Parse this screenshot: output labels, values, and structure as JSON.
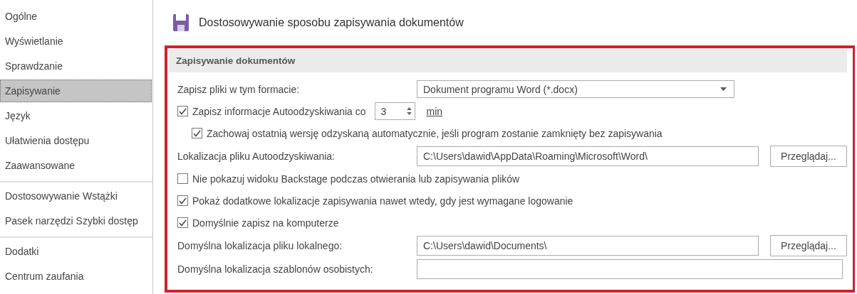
{
  "sidebar": {
    "groups": [
      [
        {
          "label": "Ogólne",
          "selected": false
        },
        {
          "label": "Wyświetlanie",
          "selected": false
        },
        {
          "label": "Sprawdzanie",
          "selected": false
        },
        {
          "label": "Zapisywanie",
          "selected": true
        },
        {
          "label": "Język",
          "selected": false
        },
        {
          "label": "Ułatwienia dostępu",
          "selected": false
        },
        {
          "label": "Zaawansowane",
          "selected": false
        }
      ],
      [
        {
          "label": "Dostosowywanie Wstążki",
          "selected": false
        },
        {
          "label": "Pasek narzędzi Szybki dostęp",
          "selected": false
        }
      ],
      [
        {
          "label": "Dodatki",
          "selected": false
        },
        {
          "label": "Centrum zaufania",
          "selected": false
        }
      ]
    ]
  },
  "page": {
    "title": "Dostosowywanie sposobu zapisywania dokumentów"
  },
  "section": {
    "title": "Zapisywanie dokumentów",
    "rows": [
      {
        "kind": "select",
        "label": "Zapisz pliki w tym formacie:",
        "value": "Dokument programu Word (*.docx)"
      },
      {
        "kind": "spin",
        "checked": true,
        "label": "Zapisz informacje Autoodzyskiwania co",
        "value": "3",
        "unit": "min"
      },
      {
        "kind": "subcheckbox",
        "checked": true,
        "label": "Zachowaj ostatnią wersję odzyskaną automatycznie, jeśli program zostanie zamknięty bez zapisywania"
      },
      {
        "kind": "path",
        "label": "Lokalizacja pliku Autoodzyskiwania:",
        "value": "C:\\Users\\dawid\\AppData\\Roaming\\Microsoft\\Word\\",
        "button": "Przeglądaj..."
      },
      {
        "kind": "checkbox",
        "checked": false,
        "label": "Nie pokazuj widoku Backstage podczas otwierania lub zapisywania plików"
      },
      {
        "kind": "checkbox",
        "checked": true,
        "label": "Pokaż dodatkowe lokalizacje zapisywania nawet wtedy, gdy jest wymagane logowanie"
      },
      {
        "kind": "checkbox",
        "checked": true,
        "label": "Domyślnie zapisz na komputerze"
      },
      {
        "kind": "path",
        "label": "Domyślna lokalizacja pliku lokalnego:",
        "value": "C:\\Users\\dawid\\Documents\\",
        "button": "Przeglądaj..."
      },
      {
        "kind": "path",
        "label": "Domyślna lokalizacja szablonów osobistych:"
      }
    ]
  }
}
